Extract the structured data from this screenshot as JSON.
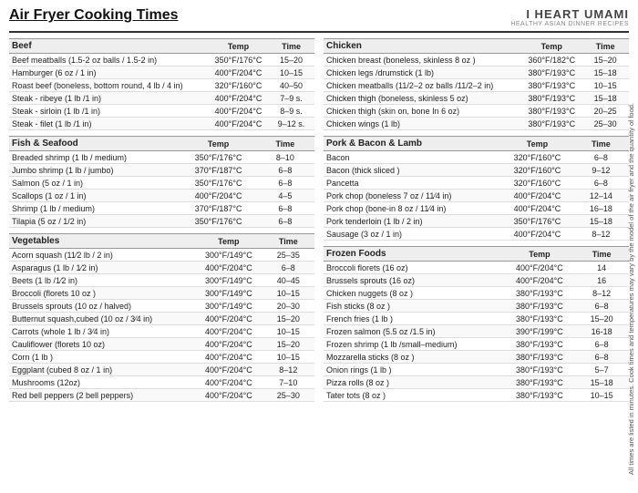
{
  "header": {
    "title": "Air Fryer Cooking Times",
    "brand_main": "I HEART UMAMI",
    "brand_sub": "HEALTHY ASIAN DINNER RECIPES"
  },
  "sections": [
    {
      "id": "beef",
      "name": "Beef",
      "headers": [
        "Beef",
        "Temp",
        "Time"
      ],
      "rows": [
        [
          "Beef meatballs (1.5-2 oz balls / 1.5-2 in)",
          "350°F/176°C",
          "15–20"
        ],
        [
          "Hamburger (6 oz / 1 in)",
          "400°F/204°C",
          "10–15"
        ],
        [
          "Roast beef (boneless, bottom round, 4 lb / 4 in)",
          "320°F/160°C",
          "40–50"
        ],
        [
          "Steak - ribeye (1 lb /1 in)",
          "400°F/204°C",
          "7–9 s."
        ],
        [
          "Steak - sirloin (1 lb /1 in)",
          "400°F/204°C",
          "8–9 s."
        ],
        [
          "Steak - filet (1 lb /1 in)",
          "400°F/204°C",
          "9–12 s."
        ]
      ]
    },
    {
      "id": "chicken",
      "name": "Chicken",
      "headers": [
        "Chicken",
        "Temp",
        "Time"
      ],
      "rows": [
        [
          "Chicken breast (boneless, skinless 8 oz )",
          "360°F/182°C",
          "15–20"
        ],
        [
          "Chicken legs /drumstick (1 lb)",
          "380°F/193°C",
          "15–18"
        ],
        [
          "Chicken meatballs (11/2–2 oz balls /11/2–2 in)",
          "380°F/193°C",
          "10–15"
        ],
        [
          "Chicken thigh (boneless, skinless 5 oz)",
          "380°F/193°C",
          "15–18"
        ],
        [
          "Chicken thigh (skin on, bone In 6 oz)",
          "380°F/193°C",
          "20–25"
        ],
        [
          "Chicken wings (1 lb)",
          "380°F/193°C",
          "25–30"
        ]
      ]
    },
    {
      "id": "fish",
      "name": "Fish & Seafood",
      "headers": [
        "Fish & Seafood",
        "Temp",
        "Time"
      ],
      "rows": [
        [
          "Breaded shrimp (1 lb / medium)",
          "350°F/176°C",
          "8–10"
        ],
        [
          "Jumbo shrimp (1 lb / jumbo)",
          "370°F/187°C",
          "6–8"
        ],
        [
          "Salmon (5 oz / 1 in)",
          "350°F/176°C",
          "6–8"
        ],
        [
          "Scallops (1 oz / 1 in)",
          "400°F/204°C",
          "4–5"
        ],
        [
          "Shrimp (1 lb / medium)",
          "370°F/187°C",
          "6–8"
        ],
        [
          "Tilapia (5 oz / 1/2 in)",
          "350°F/176°C",
          "6–8"
        ]
      ]
    },
    {
      "id": "pork",
      "name": "Pork & Bacon & Lamb",
      "headers": [
        "Pork & Bacon & Lamb",
        "Temp",
        "Time"
      ],
      "rows": [
        [
          "Bacon",
          "320°F/160°C",
          "6–8"
        ],
        [
          "Bacon (thick sliced )",
          "320°F/160°C",
          "9–12"
        ],
        [
          "Pancetta",
          "320°F/160°C",
          "6–8"
        ],
        [
          "Pork chop (boneless 7 oz / 11⁄4 in)",
          "400°F/204°C",
          "12–14"
        ],
        [
          "Pork chop (bone-in 8 oz / 11⁄4 in)",
          "400°F/204°C",
          "16–18"
        ],
        [
          "Pork tenderloin (1 lb / 2 in)",
          "350°F/176°C",
          "15–18"
        ],
        [
          "Sausage (3 oz / 1 in)",
          "400°F/204°C",
          "8–12"
        ]
      ]
    },
    {
      "id": "vegetables",
      "name": "Vegetables",
      "headers": [
        "Vegetables",
        "Temp",
        "Time"
      ],
      "rows": [
        [
          "Acorn squash (11⁄2 lb / 2 in)",
          "300°F/149°C",
          "25–35"
        ],
        [
          "Asparagus (1 lb / 1⁄2 in)",
          "400°F/204°C",
          "6–8"
        ],
        [
          "Beets (1 lb /1⁄2 in)",
          "300°F/149°C",
          "40–45"
        ],
        [
          "Broccoli (florets 10 oz )",
          "300°F/149°C",
          "10–15"
        ],
        [
          "Brussels sprouts (10 oz / halved)",
          "300°F/149°C",
          "20–30"
        ],
        [
          "Butternut squash,cubed (10 oz / 3⁄4 in)",
          "400°F/204°C",
          "15–20"
        ],
        [
          "Carrots (whole 1 lb / 3⁄4 in)",
          "400°F/204°C",
          "10–15"
        ],
        [
          "Cauliflower (florets 10 oz)",
          "400°F/204°C",
          "15–20"
        ],
        [
          "Corn (1 lb )",
          "400°F/204°C",
          "10–15"
        ],
        [
          "Eggplant (cubed 8 oz / 1 in)",
          "400°F/204°C",
          "8–12"
        ],
        [
          "Mushrooms (12oz)",
          "400°F/204°C",
          "7–10"
        ],
        [
          "Red bell peppers (2 bell peppers)",
          "400°F/204°C",
          "25–30"
        ]
      ]
    },
    {
      "id": "frozen",
      "name": "Frozen Foods",
      "headers": [
        "Frozen Foods",
        "Temp",
        "Time"
      ],
      "rows": [
        [
          "Broccoli florets (16 oz)",
          "400°F/204°C",
          "14"
        ],
        [
          "Brussels sprouts (16 oz)",
          "400°F/204°C",
          "16"
        ],
        [
          "Chicken nuggets (8 oz )",
          "380°F/193°C",
          "8–12"
        ],
        [
          "Fish sticks (8 oz )",
          "380°F/193°C",
          "6–8"
        ],
        [
          "French fries (1 lb )",
          "380°F/193°C",
          "15–20"
        ],
        [
          "Frozen salmon (5.5 oz /1.5 in)",
          "390°F/199°C",
          "16-18"
        ],
        [
          "Frozen shrimp (1 lb /small–medium)",
          "380°F/193°C",
          "6–8"
        ],
        [
          "Mozzarella sticks (8 oz )",
          "380°F/193°C",
          "6–8"
        ],
        [
          "Onion rings (1 lb )",
          "380°F/193°C",
          "5–7"
        ],
        [
          "Pizza rolls (8 oz )",
          "380°F/193°C",
          "15–18"
        ],
        [
          "Tater tots (8 oz )",
          "380°F/193°C",
          "10–15"
        ]
      ]
    }
  ],
  "sidenote": "All times are listed in minutes. Cook times and temperatures may vary by the model of the air fryer and the quantity of food."
}
